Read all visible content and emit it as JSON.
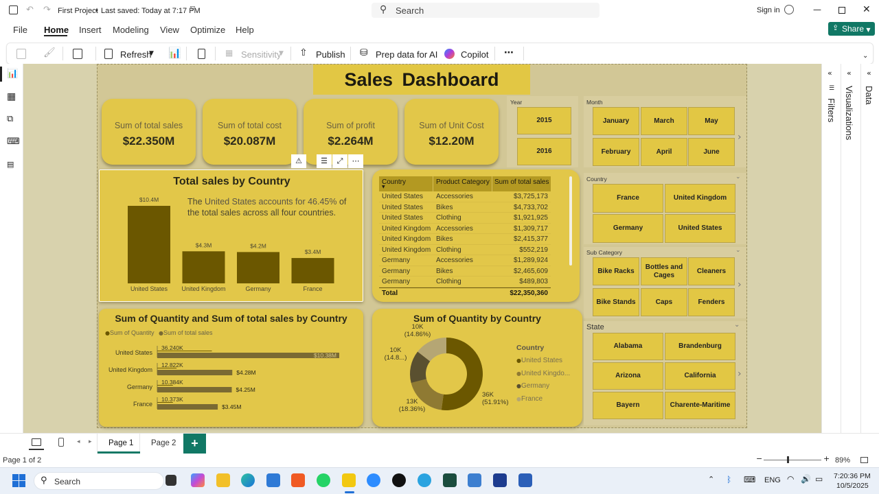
{
  "window": {
    "project": "First Project",
    "saved": "Last saved: Today at 7:17 PM",
    "search_placeholder": "Search",
    "sign_in": "Sign in"
  },
  "menu": {
    "items": [
      "File",
      "Home",
      "Insert",
      "Modeling",
      "View",
      "Optimize",
      "Help"
    ],
    "active": "Home",
    "share": "Share"
  },
  "ribbon": {
    "refresh": "Refresh",
    "sensitivity": "Sensitivity",
    "publish": "Publish",
    "prep_ai": "Prep data for AI",
    "copilot": "Copilot"
  },
  "dashboard": {
    "title": "Sales Dashboard",
    "kpis": [
      {
        "label": "Sum of total sales",
        "value": "$22.350M"
      },
      {
        "label": "Sum of total cost",
        "value": "$20.087M"
      },
      {
        "label": "Sum of profit",
        "value": "$2.264M"
      },
      {
        "label": "Sum of Unit Cost",
        "value": "$12.20M"
      }
    ],
    "year_slicer": {
      "title": "Year",
      "items": [
        "2015",
        "2016"
      ]
    },
    "month_slicer": {
      "title": "Month",
      "items": [
        "January",
        "March",
        "May",
        "February",
        "April",
        "June"
      ]
    },
    "country_slicer": {
      "title": "Country",
      "items": [
        "France",
        "United Kingdom",
        "Germany",
        "United States"
      ]
    },
    "subcategory_slicer": {
      "title": "Sub Category",
      "items": [
        "Bike Racks",
        "Bottles and Cages",
        "Cleaners",
        "Bike Stands",
        "Caps",
        "Fenders"
      ]
    },
    "state_slicer": {
      "title": "State",
      "items": [
        "Alabama",
        "Brandenburg",
        "Arizona",
        "California",
        "Bayern",
        "Charente-Maritime"
      ]
    },
    "table": {
      "headers": [
        "Country",
        "Product Category",
        "Sum of total sales"
      ],
      "rows": [
        [
          "United States",
          "Accessories",
          "$3,725,173"
        ],
        [
          "United States",
          "Bikes",
          "$4,733,702"
        ],
        [
          "United States",
          "Clothing",
          "$1,921,925"
        ],
        [
          "United Kingdom",
          "Accessories",
          "$1,309,717"
        ],
        [
          "United Kingdom",
          "Bikes",
          "$2,415,377"
        ],
        [
          "United Kingdom",
          "Clothing",
          "$552,219"
        ],
        [
          "Germany",
          "Accessories",
          "$1,289,924"
        ],
        [
          "Germany",
          "Bikes",
          "$2,465,609"
        ],
        [
          "Germany",
          "Clothing",
          "$489,803"
        ]
      ],
      "total_label": "Total",
      "total_value": "$22,350,360"
    }
  },
  "chart_data": [
    {
      "type": "bar",
      "title": "Total sales by Country",
      "categories": [
        "United States",
        "United Kingdom",
        "Germany",
        "France"
      ],
      "values": [
        10.4,
        4.3,
        4.2,
        3.4
      ],
      "labels": [
        "$10.4M",
        "$4.3M",
        "$4.2M",
        "$3.4M"
      ],
      "annotation": {
        "prefix": "The ",
        "highlight": "United States accounts for 46.45%",
        "suffix": "of the total sales across all four countries."
      },
      "color": "#6b5700"
    },
    {
      "type": "bar",
      "orientation": "horizontal",
      "title": "Sum of Quantity and Sum of total sales by Country",
      "categories": [
        "United States",
        "United Kingdom",
        "Germany",
        "France"
      ],
      "series": [
        {
          "name": "Sum of Quantity",
          "values": [
            36240,
            12822,
            10384,
            10373
          ],
          "labels": [
            "36.240K",
            "12.822K",
            "10.384K",
            "10.373K"
          ],
          "color": "#6b5700"
        },
        {
          "name": "Sum of total sales",
          "values": [
            10.38,
            4.28,
            4.25,
            3.45
          ],
          "labels": [
            "$10.38M",
            "$4.28M",
            "$4.25M",
            "$3.45M"
          ],
          "color": "#7a6a33"
        }
      ]
    },
    {
      "type": "pie",
      "variant": "donut",
      "title": "Sum of Quantity by Country",
      "legend_title": "Country",
      "categories": [
        "United States",
        "United Kingdom",
        "Germany",
        "France"
      ],
      "legend_labels": [
        "United States",
        "United Kingdo...",
        "Germany",
        "France"
      ],
      "values": [
        36,
        13,
        10,
        10
      ],
      "labels": [
        [
          "36K",
          "(51.91%)"
        ],
        [
          "13K",
          "(18.36%)"
        ],
        [
          "10K",
          "(14.8...)"
        ],
        [
          "10K",
          "(14.86%)"
        ]
      ],
      "colors": [
        "#6b5700",
        "#8f7a33",
        "#5a5030",
        "#b5a674"
      ]
    }
  ],
  "side_panels": [
    "Filters",
    "Visualizations",
    "Data"
  ],
  "pages": {
    "tabs": [
      "Page 1",
      "Page 2"
    ],
    "active": "Page 1",
    "status": "Page 1 of 2",
    "zoom": "89%"
  },
  "taskbar": {
    "search": "Search",
    "lang": "ENG",
    "time": "7:20:36 PM",
    "date": "10/5/2025"
  }
}
